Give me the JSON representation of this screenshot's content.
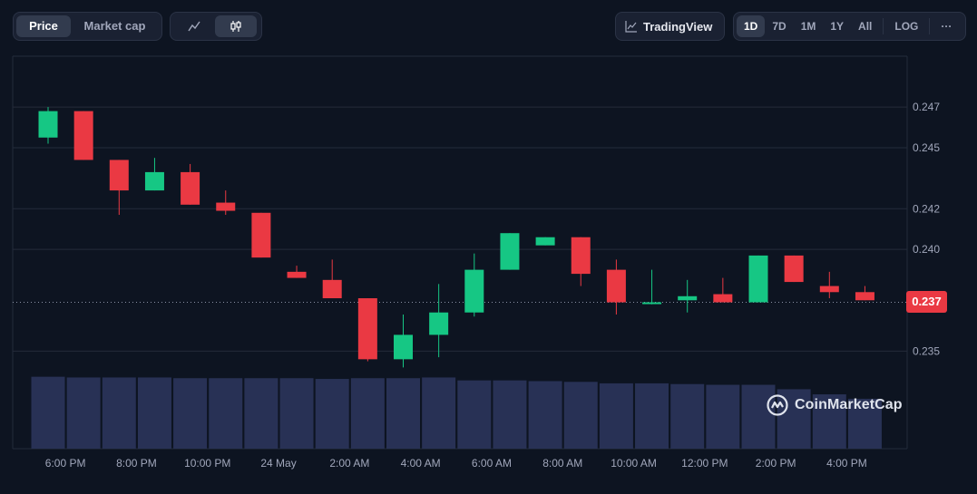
{
  "toolbar": {
    "price_label": "Price",
    "market_cap_label": "Market cap",
    "line_icon": "line-chart-icon",
    "candle_icon": "candlestick-icon",
    "tradingview_label": "TradingView",
    "tradingview_icon": "chart-trend-icon",
    "ranges": [
      "1D",
      "7D",
      "1M",
      "1Y",
      "All"
    ],
    "active_range": "1D",
    "log_label": "LOG",
    "more_label": "···"
  },
  "current_price": {
    "label": "0.237",
    "value": 0.2374,
    "color": "#ea3943"
  },
  "watermark": {
    "text": "CoinMarketCap",
    "icon": "coinmarketcap-logo-icon"
  },
  "colors": {
    "up": "#16c784",
    "down": "#ea3943",
    "volume": "#283155",
    "grid": "#242b3a",
    "background": "#0d1421"
  },
  "chart_data": {
    "type": "candlestick",
    "y_ticks": [
      "0.247",
      "0.245",
      "0.242",
      "0.240",
      "0.235"
    ],
    "ylim": [
      0.2331,
      0.2495
    ],
    "x_ticks": [
      {
        "label": "6:00 PM",
        "at": 1
      },
      {
        "label": "8:00 PM",
        "at": 3
      },
      {
        "label": "10:00 PM",
        "at": 5
      },
      {
        "label": "24 May",
        "at": 7
      },
      {
        "label": "2:00 AM",
        "at": 9
      },
      {
        "label": "4:00 AM",
        "at": 11
      },
      {
        "label": "6:00 AM",
        "at": 13
      },
      {
        "label": "8:00 AM",
        "at": 15
      },
      {
        "label": "10:00 AM",
        "at": 17
      },
      {
        "label": "12:00 PM",
        "at": 19
      },
      {
        "label": "2:00 PM",
        "at": 21
      },
      {
        "label": "4:00 PM",
        "at": 23
      }
    ],
    "candles": [
      {
        "o": 0.2455,
        "h": 0.247,
        "l": 0.2452,
        "c": 0.2468
      },
      {
        "o": 0.2468,
        "h": 0.2468,
        "l": 0.2444,
        "c": 0.2444
      },
      {
        "o": 0.2444,
        "h": 0.2444,
        "l": 0.2417,
        "c": 0.2429
      },
      {
        "o": 0.2429,
        "h": 0.2445,
        "l": 0.2429,
        "c": 0.2438
      },
      {
        "o": 0.2438,
        "h": 0.2442,
        "l": 0.2422,
        "c": 0.2422
      },
      {
        "o": 0.2423,
        "h": 0.2429,
        "l": 0.2417,
        "c": 0.2419
      },
      {
        "o": 0.2418,
        "h": 0.2418,
        "l": 0.2396,
        "c": 0.2396
      },
      {
        "o": 0.2389,
        "h": 0.2392,
        "l": 0.2386,
        "c": 0.2386
      },
      {
        "o": 0.2385,
        "h": 0.2395,
        "l": 0.2376,
        "c": 0.2376
      },
      {
        "o": 0.2376,
        "h": 0.2376,
        "l": 0.2345,
        "c": 0.2346
      },
      {
        "o": 0.2346,
        "h": 0.2368,
        "l": 0.2342,
        "c": 0.2358
      },
      {
        "o": 0.2358,
        "h": 0.2383,
        "l": 0.2347,
        "c": 0.2369
      },
      {
        "o": 0.2369,
        "h": 0.2398,
        "l": 0.2367,
        "c": 0.239
      },
      {
        "o": 0.239,
        "h": 0.2408,
        "l": 0.239,
        "c": 0.2408
      },
      {
        "o": 0.2402,
        "h": 0.2406,
        "l": 0.2402,
        "c": 0.2406
      },
      {
        "o": 0.2406,
        "h": 0.2406,
        "l": 0.2382,
        "c": 0.2388
      },
      {
        "o": 0.239,
        "h": 0.2395,
        "l": 0.2368,
        "c": 0.2374
      },
      {
        "o": 0.2374,
        "h": 0.239,
        "l": 0.2373,
        "c": 0.2374
      },
      {
        "o": 0.2375,
        "h": 0.2385,
        "l": 0.2369,
        "c": 0.2377
      },
      {
        "o": 0.2378,
        "h": 0.2386,
        "l": 0.2374,
        "c": 0.2374
      },
      {
        "o": 0.2374,
        "h": 0.2397,
        "l": 0.2374,
        "c": 0.2397
      },
      {
        "o": 0.2397,
        "h": 0.2397,
        "l": 0.2384,
        "c": 0.2384
      },
      {
        "o": 0.2382,
        "h": 0.2389,
        "l": 0.2376,
        "c": 0.2379
      },
      {
        "o": 0.2379,
        "h": 0.2382,
        "l": 0.2375,
        "c": 0.2375
      }
    ],
    "volume": [
      0.98,
      0.97,
      0.97,
      0.97,
      0.96,
      0.96,
      0.96,
      0.96,
      0.95,
      0.96,
      0.96,
      0.97,
      0.93,
      0.93,
      0.92,
      0.91,
      0.89,
      0.89,
      0.88,
      0.87,
      0.87,
      0.81,
      0.74,
      0.68
    ],
    "grid": true,
    "legend": "none"
  }
}
